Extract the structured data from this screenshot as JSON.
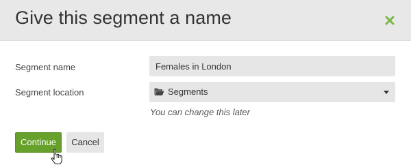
{
  "dialog": {
    "title": "Give this segment a name",
    "close_icon": "close-x-icon"
  },
  "form": {
    "name_label": "Segment name",
    "name_value": "Females in London",
    "location_label": "Segment location",
    "location_icon": "folder-icon",
    "location_value": "Segments",
    "location_hint": "You can change this later"
  },
  "actions": {
    "continue_label": "Continue",
    "cancel_label": "Cancel"
  },
  "colors": {
    "header_bg": "#e8e8e8",
    "accent_green": "#67a12c",
    "close_icon": "#7ab648",
    "input_bg": "#e6e6e6"
  },
  "cursor": {
    "type": "hand-pointer"
  }
}
